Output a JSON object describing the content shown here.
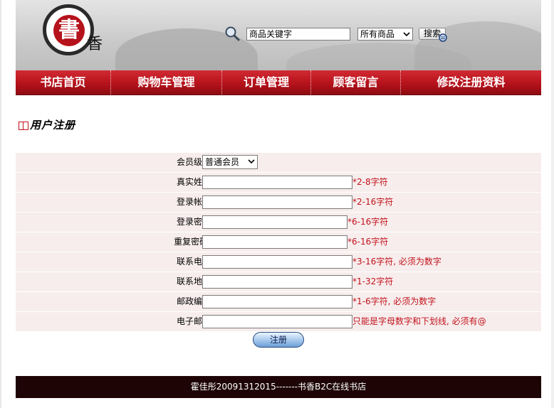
{
  "header": {
    "logo_char": "書",
    "logo_side_char": "香",
    "search": {
      "placeholder": "商品关键字",
      "value": "商品关键字"
    },
    "category": {
      "selected": "所有商品"
    },
    "search_button": "搜索"
  },
  "nav": {
    "items": [
      {
        "label": "书店首页"
      },
      {
        "label": "购物车管理"
      },
      {
        "label": "订单管理"
      },
      {
        "label": "顾客留言"
      },
      {
        "label": "修改注册资料"
      }
    ]
  },
  "section": {
    "title": "用户注册"
  },
  "form": {
    "level": {
      "label": "会员级别:",
      "selected": "普通会员"
    },
    "fields": [
      {
        "label": "真实姓名:",
        "hint_star": "*",
        "hint": "2-8字符"
      },
      {
        "label": "登录帐号:",
        "hint_star": "*",
        "hint": "2-16字符"
      },
      {
        "label": "登录密码:",
        "hint_star": "*",
        "hint": "6-16字符"
      },
      {
        "label": "重复密码 :",
        "hint_star": "*",
        "hint": "6-16字符"
      },
      {
        "label": "联系电话:",
        "hint_star": "*",
        "hint": "3-16字符, 必须为数字"
      },
      {
        "label": "联系地址:",
        "hint_star": "*",
        "hint": "1-32字符"
      },
      {
        "label": "邮政编码:",
        "hint_star": "*",
        "hint": "1-6字符, 必须为数字"
      },
      {
        "label": "电子邮箱:",
        "hint_star": "",
        "hint": "只能是字母数字和下划线, 必须有@"
      }
    ],
    "submit": "注册"
  },
  "footer": {
    "text": "霍佳彤20091312015-------书香B2C在线书店"
  },
  "colors": {
    "accent": "#b5121b",
    "footer_bg": "#1e0405",
    "row_bg": "#f7eded"
  }
}
